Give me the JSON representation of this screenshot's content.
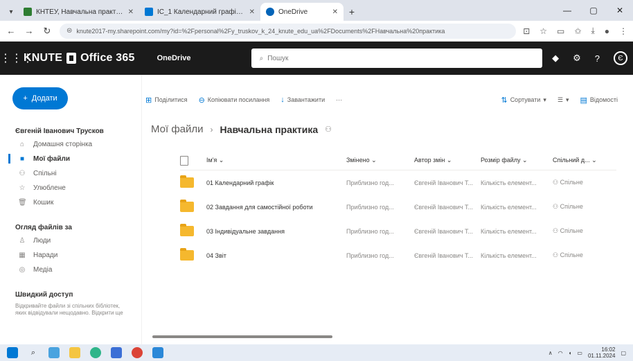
{
  "browser": {
    "tabs": [
      {
        "title": "КНТЕУ, Навчальна практика",
        "favicon_color": "#2e7d32",
        "active": false
      },
      {
        "title": "ІС_1 Календарний графік ...",
        "favicon_color": "#0078d4",
        "active": false
      },
      {
        "title": "OneDrive",
        "favicon_color": "#0364b8",
        "active": true
      }
    ],
    "url": "knute2017-my.sharepoint.com/my?id=%2Fpersonal%2Fy_truskov_k_24_knute_edu_ua%2FDocuments%2FНавчальна%20практика",
    "window_controls": [
      "—",
      "▢",
      "✕"
    ]
  },
  "suite": {
    "brand": "KNUTE",
    "product": "Office 365",
    "app_name": "OneDrive",
    "search_placeholder": "Пошук"
  },
  "nav": {
    "new_button": "Додати",
    "user_name": "Євгеній Іванович Трусков",
    "user_items": [
      {
        "label": "Домашня сторінка",
        "icon": "home-icon",
        "active": false
      },
      {
        "label": "Мої файли",
        "icon": "folder-icon",
        "active": true
      },
      {
        "label": "Спільні",
        "icon": "shared-icon",
        "active": false
      },
      {
        "label": "Улюблене",
        "icon": "star-icon",
        "active": false
      },
      {
        "label": "Кошик",
        "icon": "trash-icon",
        "active": false
      }
    ],
    "browse_title": "Огляд файлів за",
    "browse_items": [
      {
        "label": "Люди",
        "icon": "people-icon"
      },
      {
        "label": "Наради",
        "icon": "calendar-icon"
      },
      {
        "label": "Медіа",
        "icon": "media-icon"
      }
    ],
    "quick_title": "Швидкий доступ",
    "quick_desc": "Відкривайте файли зі спільних бібліотек, яких відвідували нещодавно. Відкрити ще"
  },
  "commands": {
    "left": [
      {
        "label": "Поділитися",
        "icon": "share-icon"
      },
      {
        "label": "Копіювати посилання",
        "icon": "link-icon"
      },
      {
        "label": "Завантажити",
        "icon": "download-icon"
      },
      {
        "label": "···",
        "icon": ""
      }
    ],
    "sort": "Сортувати",
    "view": "☰",
    "details": "Відомості"
  },
  "breadcrumb": {
    "root": "Мої файли",
    "current": "Навчальна практика"
  },
  "table": {
    "headers": [
      "Ім'я",
      "Змінено",
      "Автор змін",
      "Розмір файлу",
      "Спільний д..."
    ],
    "rows": [
      {
        "name": "01 Календарний графік",
        "modified": "Приблизно год...",
        "by": "Євгеній Іванович Т...",
        "size": "Кількість елемент...",
        "sharing": "Спільне"
      },
      {
        "name": "02 Завдання для самостійної роботи",
        "modified": "Приблизно год...",
        "by": "Євгеній Іванович Т...",
        "size": "Кількість елемент...",
        "sharing": "Спільне"
      },
      {
        "name": "03 Індивідуальне завдання",
        "modified": "Приблизно год...",
        "by": "Євгеній Іванович Т...",
        "size": "Кількість елемент...",
        "sharing": "Спільне"
      },
      {
        "name": "04 Звіт",
        "modified": "Приблизно год...",
        "by": "Євгеній Іванович Т...",
        "size": "Кількість елемент...",
        "sharing": "Спільне"
      }
    ]
  },
  "taskbar": {
    "time": "16:02",
    "date": "01.11.2024"
  }
}
